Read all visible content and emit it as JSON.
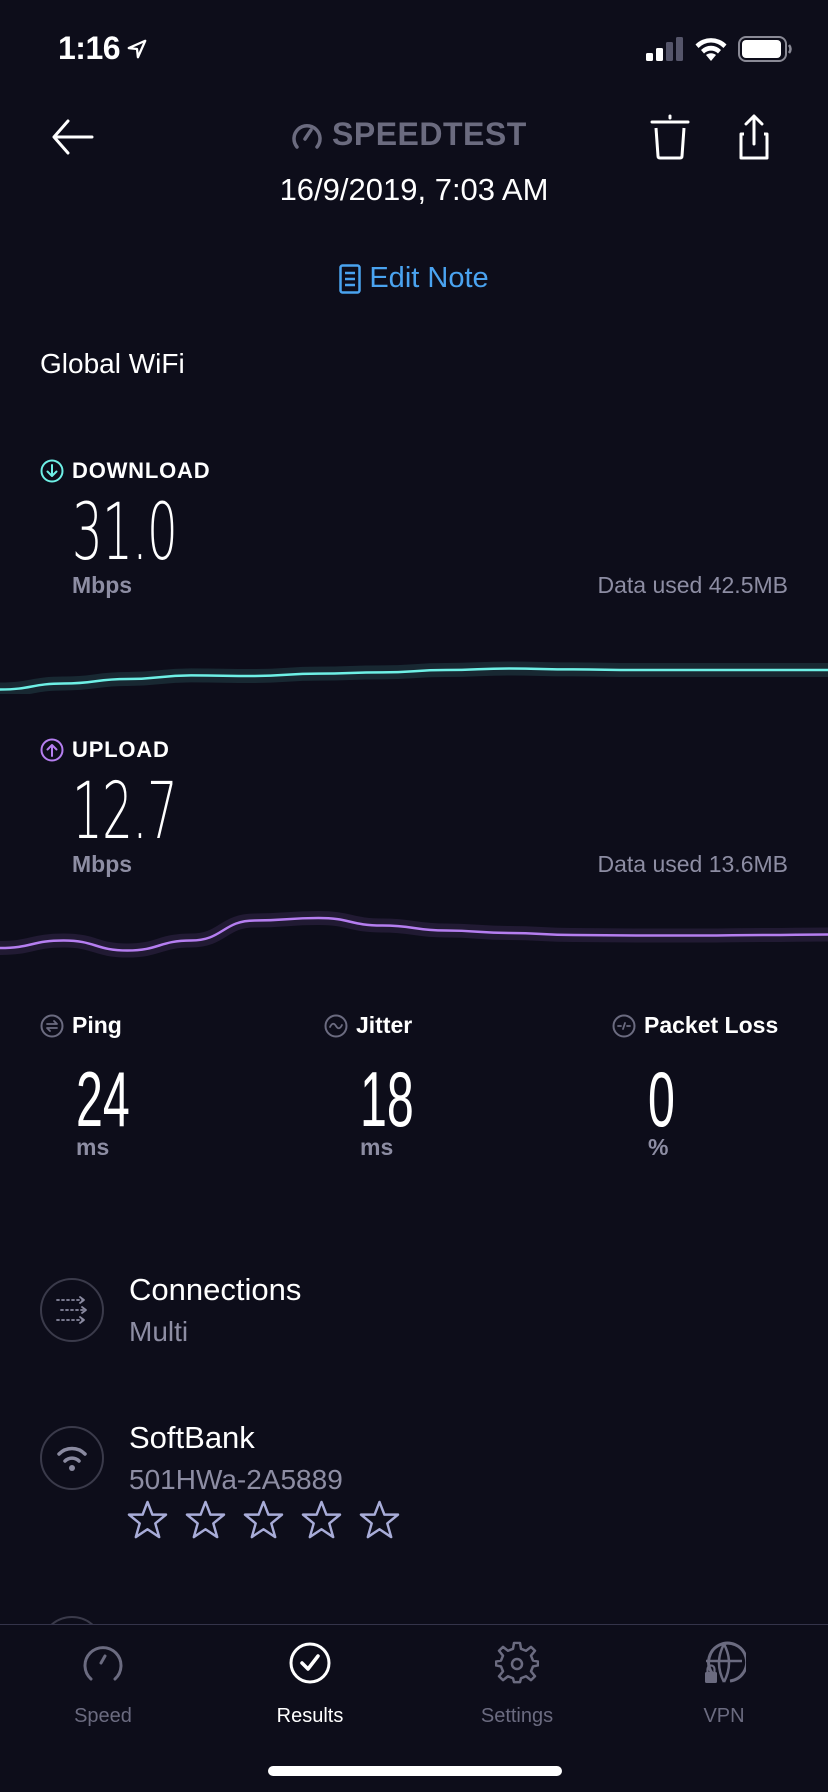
{
  "status_bar": {
    "time": "1:16",
    "location_icon": "location-arrow-icon",
    "signal_icon": "cellular-signal-icon",
    "signal_bars_active": 2,
    "signal_bars_total": 4,
    "wifi_icon": "wifi-icon",
    "battery_icon": "battery-icon",
    "battery_level_percent": 90
  },
  "header": {
    "back_icon": "arrow-left-icon",
    "logo_icon": "speedometer-icon",
    "logo_text": "SPEEDTEST",
    "delete_icon": "trash-icon",
    "share_icon": "share-icon",
    "date": "16/9/2019, 7:03 AM"
  },
  "edit_note": {
    "icon": "note-icon",
    "label": "Edit Note",
    "color": "#4aa3f0"
  },
  "network_name": "Global WiFi",
  "download": {
    "icon": "arrow-down-circle-icon",
    "title": "DOWNLOAD",
    "value": "31.0",
    "unit": "Mbps",
    "data_used": "Data used 42.5MB",
    "color": "#6ef0e6",
    "graph_relative_values": [
      0.15,
      0.35,
      0.5,
      0.62,
      0.6,
      0.68,
      0.72,
      0.8,
      0.85,
      0.82,
      0.8,
      0.8,
      0.8,
      0.8
    ]
  },
  "upload": {
    "icon": "arrow-up-circle-icon",
    "title": "UPLOAD",
    "value": "12.7",
    "unit": "Mbps",
    "data_used": "Data used 13.6MB",
    "color": "#b57ef0",
    "graph_relative_values": [
      0.3,
      0.45,
      0.25,
      0.45,
      0.85,
      0.9,
      0.75,
      0.65,
      0.6,
      0.56,
      0.55,
      0.55,
      0.56,
      0.57
    ]
  },
  "metrics": [
    {
      "icon": "ping-icon",
      "title": "Ping",
      "value": "24",
      "unit": "ms"
    },
    {
      "icon": "jitter-icon",
      "title": "Jitter",
      "value": "18",
      "unit": "ms"
    },
    {
      "icon": "packet-loss-icon",
      "title": "Packet Loss",
      "value": "0",
      "unit": "%"
    }
  ],
  "connections": {
    "icon": "multi-connection-icon",
    "title": "Connections",
    "value": "Multi"
  },
  "provider": {
    "icon": "wifi-icon",
    "name": "SoftBank",
    "server": "501HWa-2A5889",
    "rating_stars_total": 5,
    "rating_stars_filled": 0,
    "star_color": "#a8acd8"
  },
  "tab_bar": {
    "tabs": [
      {
        "icon": "speedometer-icon",
        "label": "Speed",
        "active": false
      },
      {
        "icon": "check-circle-icon",
        "label": "Results",
        "active": true
      },
      {
        "icon": "gear-icon",
        "label": "Settings",
        "active": false
      },
      {
        "icon": "globe-lock-icon",
        "label": "VPN",
        "active": false
      }
    ]
  }
}
